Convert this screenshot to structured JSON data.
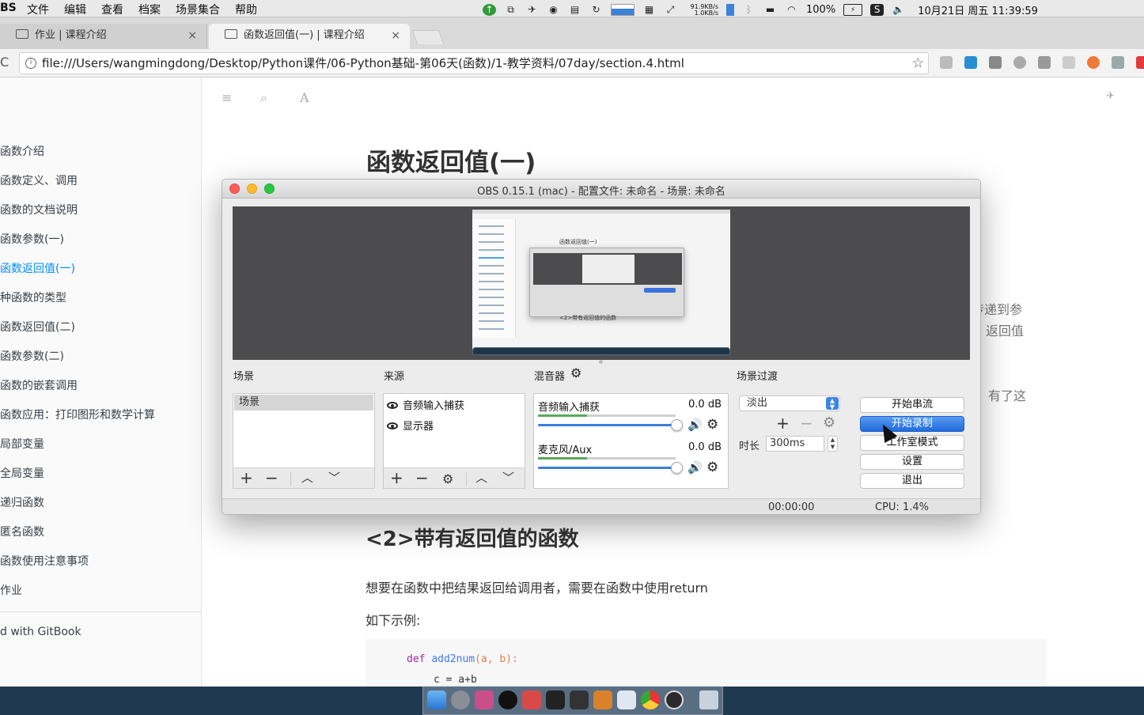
{
  "menubar": {
    "app_name": "BS",
    "menus": [
      "文件",
      "编辑",
      "查看",
      "档案",
      "场景集合",
      "帮助"
    ],
    "net_up": "91.9KB/s",
    "net_down": "1.0KB/s",
    "battery": "100%",
    "datetime": "10月21日 周五  11:39:59"
  },
  "browser": {
    "tabs": [
      {
        "label": "作业 | 课程介绍"
      },
      {
        "label": "函数返回值(一) | 课程介绍"
      }
    ],
    "url": "file:///Users/wangmingdong/Desktop/Python课件/06-Python基础-第06天(函数)/1-教学资料/07day/section.4.html"
  },
  "sidebar": {
    "items": [
      {
        "label": "函数介绍"
      },
      {
        "label": "函数定义、调用"
      },
      {
        "label": "函数的文档说明"
      },
      {
        "label": "函数参数(一)"
      },
      {
        "label": "函数返回值(一)"
      },
      {
        "label": "种函数的类型"
      },
      {
        "label": "函数返回值(二)"
      },
      {
        "label": "函数参数(二)"
      },
      {
        "label": "函数的嵌套调用"
      },
      {
        "label": "函数应用：打印图形和数学计算"
      },
      {
        "label": "局部变量"
      },
      {
        "label": "全局变量"
      },
      {
        "label": "递归函数"
      },
      {
        "label": "匿名函数"
      },
      {
        "label": "函数使用注意事项"
      },
      {
        "label": "作业"
      }
    ],
    "active_index": 4,
    "footer": "d with GitBook"
  },
  "page": {
    "title": "函数返回值(一)",
    "fragments": [
      "传递到参",
      "返回值",
      "有了这"
    ],
    "subtitle": "<2>带有返回值的函数",
    "paragraph1": "想要在函数中把结果返回给调用者，需要在函数中使用return",
    "paragraph2": "如下示例:",
    "code": {
      "kw": "def",
      "fn": "add2num",
      "params": "(a, b):",
      "line2": "c = a+b"
    }
  },
  "obs": {
    "title": "OBS 0.15.1 (mac) - 配置文件: 未命名 - 场景: 未命名",
    "sections": {
      "scenes": "场景",
      "sources": "来源",
      "mixer": "混音器",
      "transitions": "场景过渡"
    },
    "scenes": [
      "场景"
    ],
    "sources": [
      "音频输入捕获",
      "显示器"
    ],
    "mixer": [
      {
        "name": "音频输入捕获",
        "db": "0.0 dB",
        "volume": 1.0
      },
      {
        "name": "麦克风/Aux",
        "db": "0.0 dB",
        "volume": 1.0
      }
    ],
    "transition": {
      "selected": "淡出",
      "duration_label": "时长",
      "duration": "300ms"
    },
    "buttons": {
      "stream": "开始串流",
      "record": "开始录制",
      "studio": "工作室模式",
      "settings": "设置",
      "exit": "退出"
    },
    "status": {
      "time": "00:00:00",
      "cpu": "CPU: 1.4%"
    },
    "preview_thumb": {
      "title": "函数返回值(一)",
      "subtitle": "<2>带有返回值的函数"
    }
  },
  "colors": {
    "accent_link": "#008cff",
    "obs_primary": "#1f6bdc",
    "dock": "#1f3a50"
  }
}
